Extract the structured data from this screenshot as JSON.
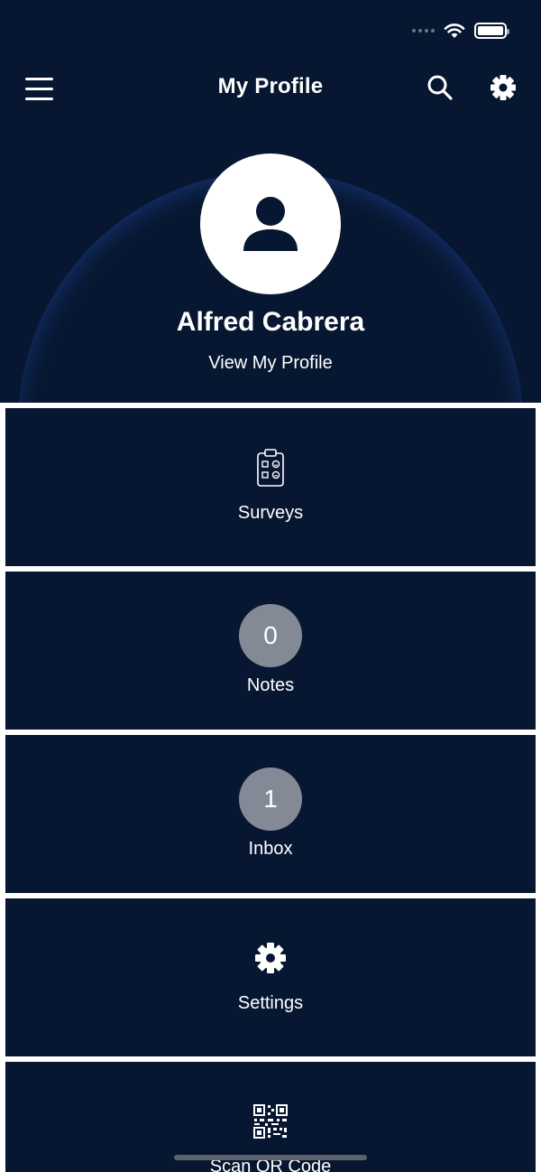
{
  "app": {
    "title": "My Profile"
  },
  "header": {
    "menu_icon": "hamburger-menu-icon",
    "search_icon": "search-icon",
    "settings_icon": "gear-icon"
  },
  "profile": {
    "name": "Alfred Cabrera",
    "link": "View My Profile",
    "avatar_icon": "person-icon"
  },
  "tiles": [
    {
      "label": "Surveys",
      "icon": "clipboard-survey-icon"
    },
    {
      "label": "Notes",
      "count": "0"
    },
    {
      "label": "Inbox",
      "count": "1"
    },
    {
      "label": "Settings",
      "icon": "gear-icon"
    },
    {
      "label": "Scan QR Code",
      "icon": "qr-code-icon"
    }
  ],
  "colors": {
    "background": "#071731",
    "badge": "#838a96",
    "accent_arc": "#3b73e6"
  }
}
